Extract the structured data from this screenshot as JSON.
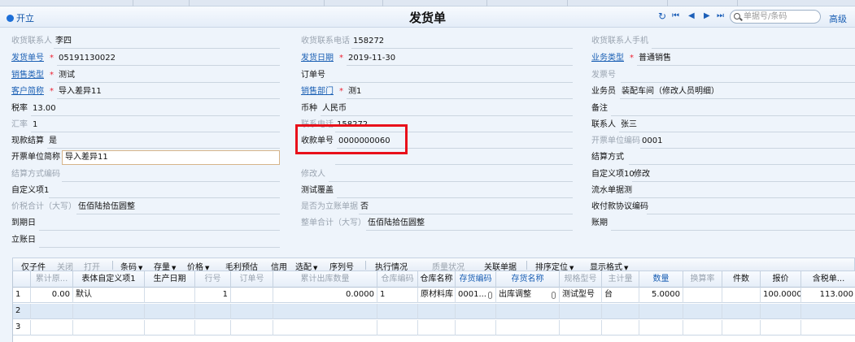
{
  "header": {
    "open_label": "开立",
    "title": "发货单",
    "search_placeholder": "单据号/条码",
    "advanced": "高级",
    "nav": {
      "refresh": "↻",
      "first": "⏮",
      "prev": "◀",
      "next": "▶",
      "last": "⏭"
    }
  },
  "form": {
    "receiver_contact": {
      "label": "收货联系人",
      "value": "李四"
    },
    "receiver_phone": {
      "label": "收货联系电话",
      "value": "158272"
    },
    "receiver_mobile": {
      "label": "收货联系人手机",
      "value": ""
    },
    "ship_no": {
      "label": "发货单号",
      "value": "05191130022"
    },
    "ship_date": {
      "label": "发货日期",
      "value": "2019-11-30"
    },
    "business_type": {
      "label": "业务类型",
      "value": "普通销售"
    },
    "sales_type": {
      "label": "销售类型",
      "value": "测试"
    },
    "order_no": {
      "label": "订单号",
      "value": ""
    },
    "invoice_no": {
      "label": "发票号",
      "value": ""
    },
    "customer_abbr": {
      "label": "客户简称",
      "value": "导入差异11"
    },
    "sales_dept": {
      "label": "销售部门",
      "value": "测1"
    },
    "salesman": {
      "label": "业务员",
      "value": "装配车间（修改人员明细）"
    },
    "tax_rate": {
      "label": "税率",
      "value": "13.00"
    },
    "currency": {
      "label": "币种",
      "value": "人民币"
    },
    "remark": {
      "label": "备注",
      "value": ""
    },
    "exchange_rate": {
      "label": "汇率",
      "value": "1"
    },
    "contact_phone": {
      "label": "联系电话",
      "value": "158272"
    },
    "contact_person": {
      "label": "联系人",
      "value": "张三"
    },
    "cash_settle": {
      "label": "现款结算",
      "value": "是"
    },
    "receipt_no": {
      "label": "收款单号",
      "value": "0000000060"
    },
    "invoice_unit_code": {
      "label": "开票单位编码",
      "value": "0001"
    },
    "invoice_unit_abbr": {
      "label": "开票单位简称",
      "value": "导入差异11"
    },
    "field_hidden": {
      "label": "",
      "value": ""
    },
    "settle_method": {
      "label": "结算方式",
      "value": ""
    },
    "settle_code": {
      "label": "结算方式编码",
      "value": ""
    },
    "modifier": {
      "label": "修改人",
      "value": ""
    },
    "custom10": {
      "label": "自定义项10",
      "value": "修改"
    },
    "custom1": {
      "label": "自定义项1",
      "value": ""
    },
    "test_cover": {
      "label": "测试覆盖",
      "value": ""
    },
    "flow_doc": {
      "label": "流水单据测",
      "value": ""
    },
    "total_words": {
      "label": "价税合计（大写）",
      "value": "伍佰陆拾伍圆整"
    },
    "is_immediate": {
      "label": "是否为立账单据",
      "value": "否"
    },
    "payment_code": {
      "label": "收付款协议编码",
      "value": ""
    },
    "due_date": {
      "label": "到期日",
      "value": ""
    },
    "whole_total": {
      "label": "整单合计（大写）",
      "value": "伍佰陆拾伍圆整"
    },
    "account_period": {
      "label": "账期",
      "value": ""
    },
    "account_date": {
      "label": "立账日",
      "value": ""
    }
  },
  "toolbar": {
    "items": [
      "仅子件",
      "关闭",
      "打开",
      "条码",
      "存量",
      "价格",
      "毛利预估",
      "信用",
      "选配",
      "序列号",
      "执行情况",
      "质量状况",
      "关联单据",
      "排序定位",
      "显示格式"
    ]
  },
  "table": {
    "columns": [
      "",
      "累计原...",
      "表体自定义项1",
      "生产日期",
      "行号",
      "订单号",
      "累计出库数量",
      "仓库编码",
      "仓库名称",
      "存货编码",
      "存货名称",
      "规格型号",
      "主计量",
      "数量",
      "换算率",
      "件数",
      "报价",
      "含税单..."
    ],
    "rows": [
      [
        "1",
        "0.00",
        "默认",
        "",
        "1",
        "",
        "0.0000",
        "1",
        "原材料库",
        "0001...",
        "出库调整",
        "测试型号",
        "台",
        "5.0000",
        "",
        "",
        "100.000000",
        "113.000"
      ],
      [
        "2",
        "",
        "",
        "",
        "",
        "",
        "",
        "",
        "",
        "",
        "",
        "",
        "",
        "",
        "",
        "",
        "",
        ""
      ],
      [
        "3",
        "",
        "",
        "",
        "",
        "",
        "",
        "",
        "",
        "",
        "",
        "",
        "",
        "",
        "",
        "",
        "",
        ""
      ]
    ]
  },
  "colors": {
    "accent": "#1a5fb4",
    "highlight_box": "#e8101a",
    "required": "#e23"
  }
}
